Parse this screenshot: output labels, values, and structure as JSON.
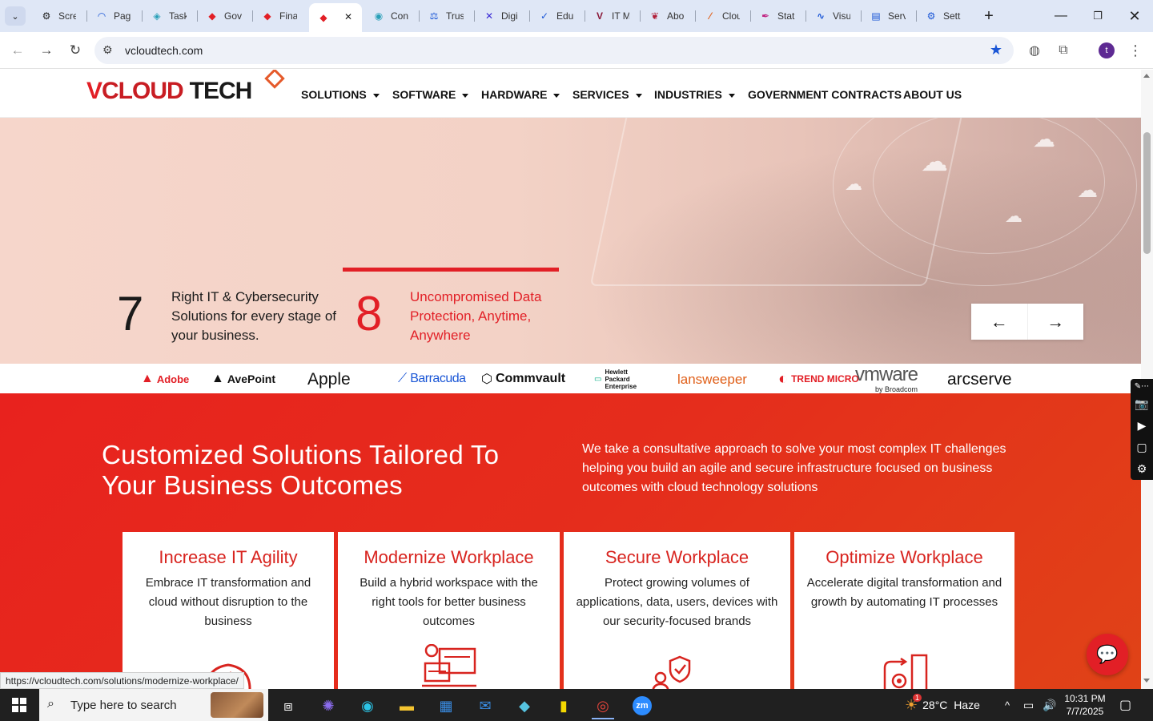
{
  "browser": {
    "tabs": [
      {
        "title": "Scre",
        "icon": "gear-icon",
        "color": "#222"
      },
      {
        "title": "Pag",
        "icon": "speed-icon",
        "color": "#1a56d6"
      },
      {
        "title": "Task",
        "icon": "task-icon",
        "color": "#2aa0b8"
      },
      {
        "title": "Gov",
        "icon": "diamond-icon",
        "color": "#e21f26"
      },
      {
        "title": "Fina",
        "icon": "diamond-icon",
        "color": "#e21f26"
      },
      {
        "title": "",
        "icon": "diamond-icon",
        "color": "#e21f26",
        "active": true
      },
      {
        "title": "Con",
        "icon": "globe-icon",
        "color": "#2aa0b8"
      },
      {
        "title": "Trus",
        "icon": "scale-icon",
        "color": "#1a56d6"
      },
      {
        "title": "Digi",
        "icon": "x-icon",
        "color": "#3a2ad6"
      },
      {
        "title": "Edu",
        "icon": "check-icon",
        "color": "#1a56d6"
      },
      {
        "title": "IT M",
        "icon": "v-icon",
        "color": "#8a1a3a"
      },
      {
        "title": "Abo",
        "icon": "leaf-icon",
        "color": "#b0203a"
      },
      {
        "title": "Clou",
        "icon": "slash-icon",
        "color": "#e0601a"
      },
      {
        "title": "Stat",
        "icon": "pen-icon",
        "color": "#c02080"
      },
      {
        "title": "Visu",
        "icon": "wave-icon",
        "color": "#1a56d6"
      },
      {
        "title": "Serv",
        "icon": "doc-icon",
        "color": "#1a56d6"
      },
      {
        "title": "Sett",
        "icon": "gear-icon",
        "color": "#1a56d6"
      }
    ],
    "url": "vcloudtech.com",
    "profile_initial": "t",
    "status_url": "https://vcloudtech.com/solutions/modernize-workplace/"
  },
  "site": {
    "logo": {
      "v": "V",
      "cloud": "CLOUD",
      "tech": "TECH"
    },
    "menu": [
      {
        "label": "SOLUTIONS",
        "caret": true
      },
      {
        "label": "SOFTWARE",
        "caret": true
      },
      {
        "label": "HARDWARE",
        "caret": true
      },
      {
        "label": "SERVICES",
        "caret": true
      },
      {
        "label": "INDUSTRIES",
        "caret": true
      },
      {
        "label": "GOVERNMENT CONTRACTS",
        "caret": false
      },
      {
        "label": "ABOUT US",
        "caret": false
      }
    ],
    "hero": {
      "stats": [
        {
          "num": "7",
          "text": "Right IT & Cybersecurity Solutions for every stage of your business.",
          "active": false
        },
        {
          "num": "8",
          "text": "Uncompromised Data Protection, Anytime, Anywhere",
          "active": true
        }
      ],
      "prev_arrow": "←",
      "next_arrow": "→"
    },
    "partners": [
      {
        "name": "Adobe",
        "color": "#e21f26"
      },
      {
        "name": "AvePoint",
        "color": "#111"
      },
      {
        "name": "Apple",
        "color": "#111"
      },
      {
        "name": "Barracuda",
        "color": "#1a56d6"
      },
      {
        "name": "Commvault",
        "color": "#111"
      },
      {
        "name": "Hewlett Packard Enterprise",
        "color": "#111"
      },
      {
        "name": "lansweeper",
        "color": "#e0601a"
      },
      {
        "name": "TREND MICRO",
        "color": "#e21f26"
      },
      {
        "name": "vmware",
        "sub": "by Broadcom",
        "color": "#555"
      },
      {
        "name": "arcserve",
        "color": "#111"
      }
    ],
    "solutions": {
      "title": "Customized Solutions Tailored To Your Business Outcomes",
      "description": "We take a consultative approach to solve your most complex IT challenges helping you build an agile and secure infrastructure focused on business outcomes with cloud technology solutions",
      "cards": [
        {
          "title": "Increase IT Agility",
          "desc": "Embrace IT transformation and cloud without disruption to the business"
        },
        {
          "title": "Modernize Workplace",
          "desc": "Build a hybrid workspace with the right tools for better business outcomes"
        },
        {
          "title": "Secure Workplace",
          "desc": "Protect growing volumes of applications, data, users, devices with our security-focused brands"
        },
        {
          "title": "Optimize Workplace",
          "desc": "Accelerate digital transformation and growth by automating IT processes"
        }
      ]
    },
    "accent_color": "#e21f26"
  },
  "taskbar": {
    "search_placeholder": "Type here to search",
    "weather": "28°C  Haze",
    "weather_badge": "1",
    "time": "10:31 PM",
    "date": "7/7/2025"
  }
}
